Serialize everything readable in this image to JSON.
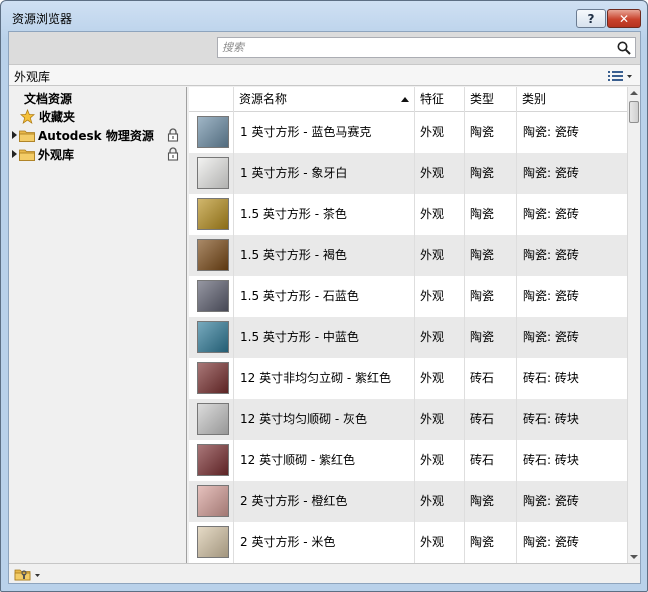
{
  "window": {
    "title": "资源浏览器",
    "help_label": "?",
    "close_label": "✕"
  },
  "search": {
    "placeholder": "搜索"
  },
  "library": {
    "title": "外观库"
  },
  "tree": {
    "items": [
      {
        "label": "文档资源"
      },
      {
        "label": "收藏夹"
      },
      {
        "label": "Autodesk 物理资源"
      },
      {
        "label": "外观库"
      }
    ]
  },
  "grid": {
    "columns": [
      "资源名称",
      "特征",
      "类型",
      "类别"
    ],
    "sort": "ascending",
    "rows": [
      {
        "name": "1 英寸方形 - 蓝色马赛克",
        "feature": "外观",
        "type": "陶瓷",
        "category": "陶瓷: 瓷砖",
        "swatch": "#6d8fa8"
      },
      {
        "name": "1 英寸方形 - 象牙白",
        "feature": "外观",
        "type": "陶瓷",
        "category": "陶瓷: 瓷砖",
        "swatch": "#ececea"
      },
      {
        "name": "1.5 英寸方形 - 茶色",
        "feature": "外观",
        "type": "陶瓷",
        "category": "陶瓷: 瓷砖",
        "swatch": "#b8901e"
      },
      {
        "name": "1.5 英寸方形 - 褐色",
        "feature": "外观",
        "type": "陶瓷",
        "category": "陶瓷: 瓷砖",
        "swatch": "#7b4a16"
      },
      {
        "name": "1.5 英寸方形 - 石蓝色",
        "feature": "外观",
        "type": "陶瓷",
        "category": "陶瓷: 瓷砖",
        "swatch": "#5d5f70"
      },
      {
        "name": "1.5 英寸方形 - 中蓝色",
        "feature": "外观",
        "type": "陶瓷",
        "category": "陶瓷: 瓷砖",
        "swatch": "#2f7c9a"
      },
      {
        "name": "12 英寸非均匀立砌 - 紫红色",
        "feature": "外观",
        "type": "砖石",
        "category": "砖石: 砖块",
        "swatch": "#7a2f2f"
      },
      {
        "name": "12 英寸均匀顺砌 - 灰色",
        "feature": "外观",
        "type": "砖石",
        "category": "砖石: 砖块",
        "swatch": "#c9c9c9"
      },
      {
        "name": "12 英寸顺砌 - 紫红色",
        "feature": "外观",
        "type": "砖石",
        "category": "砖石: 砖块",
        "swatch": "#7b2e31"
      },
      {
        "name": "2 英寸方形 - 橙红色",
        "feature": "外观",
        "type": "陶瓷",
        "category": "陶瓷: 瓷砖",
        "swatch": "#d8a09a"
      },
      {
        "name": "2 英寸方形 - 米色",
        "feature": "外观",
        "type": "陶瓷",
        "category": "陶瓷: 瓷砖",
        "swatch": "#d8c7a8"
      }
    ]
  }
}
